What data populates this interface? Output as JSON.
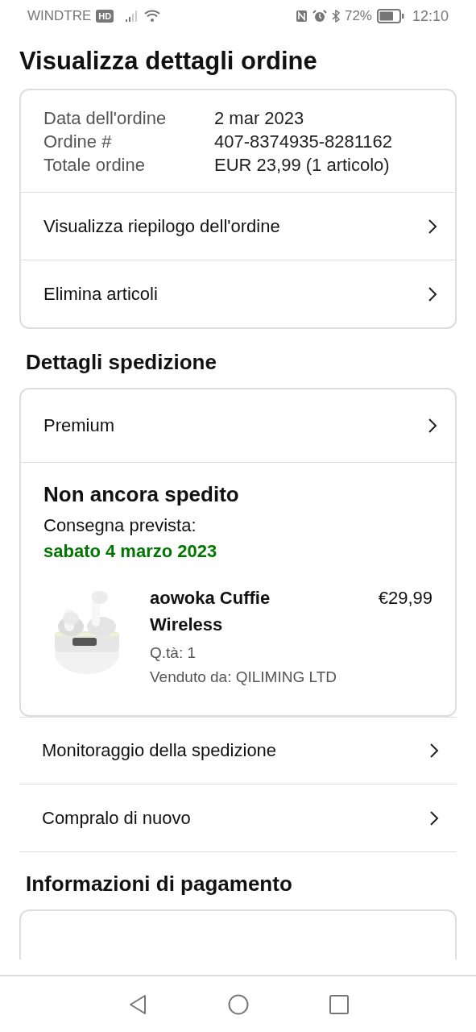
{
  "status_bar": {
    "carrier": "WINDTRE",
    "carrier_badge": "HD",
    "battery_percent": "72%",
    "time": "12:10"
  },
  "title": "Visualizza dettagli ordine",
  "order_summary": {
    "fields": [
      {
        "label": "Data dell'ordine",
        "value": "2 mar 2023"
      },
      {
        "label": "Ordine #",
        "value": "407-8374935-8281162"
      },
      {
        "label": "Totale ordine",
        "value": "EUR 23,99 (1 articolo)"
      }
    ],
    "links": [
      "Visualizza riepilogo dell'ordine",
      "Elimina articoli"
    ]
  },
  "shipping": {
    "heading": "Dettagli spedizione",
    "link": "Premium",
    "status": "Non ancora spedito",
    "delivery_label": "Consegna prevista:",
    "delivery_date": "sabato 4 marzo 2023",
    "item": {
      "kind": "picture",
      "name": "aowoka Cuffie Wireless",
      "price": "€29,99",
      "quantity": "Q.tà: 1",
      "seller": "Venduto da: QILIMING LTD"
    },
    "links": [
      "Monitoraggio della spedizione",
      "Compralo di nuovo"
    ]
  },
  "payment": {
    "heading": "Informazioni di pagamento"
  }
}
